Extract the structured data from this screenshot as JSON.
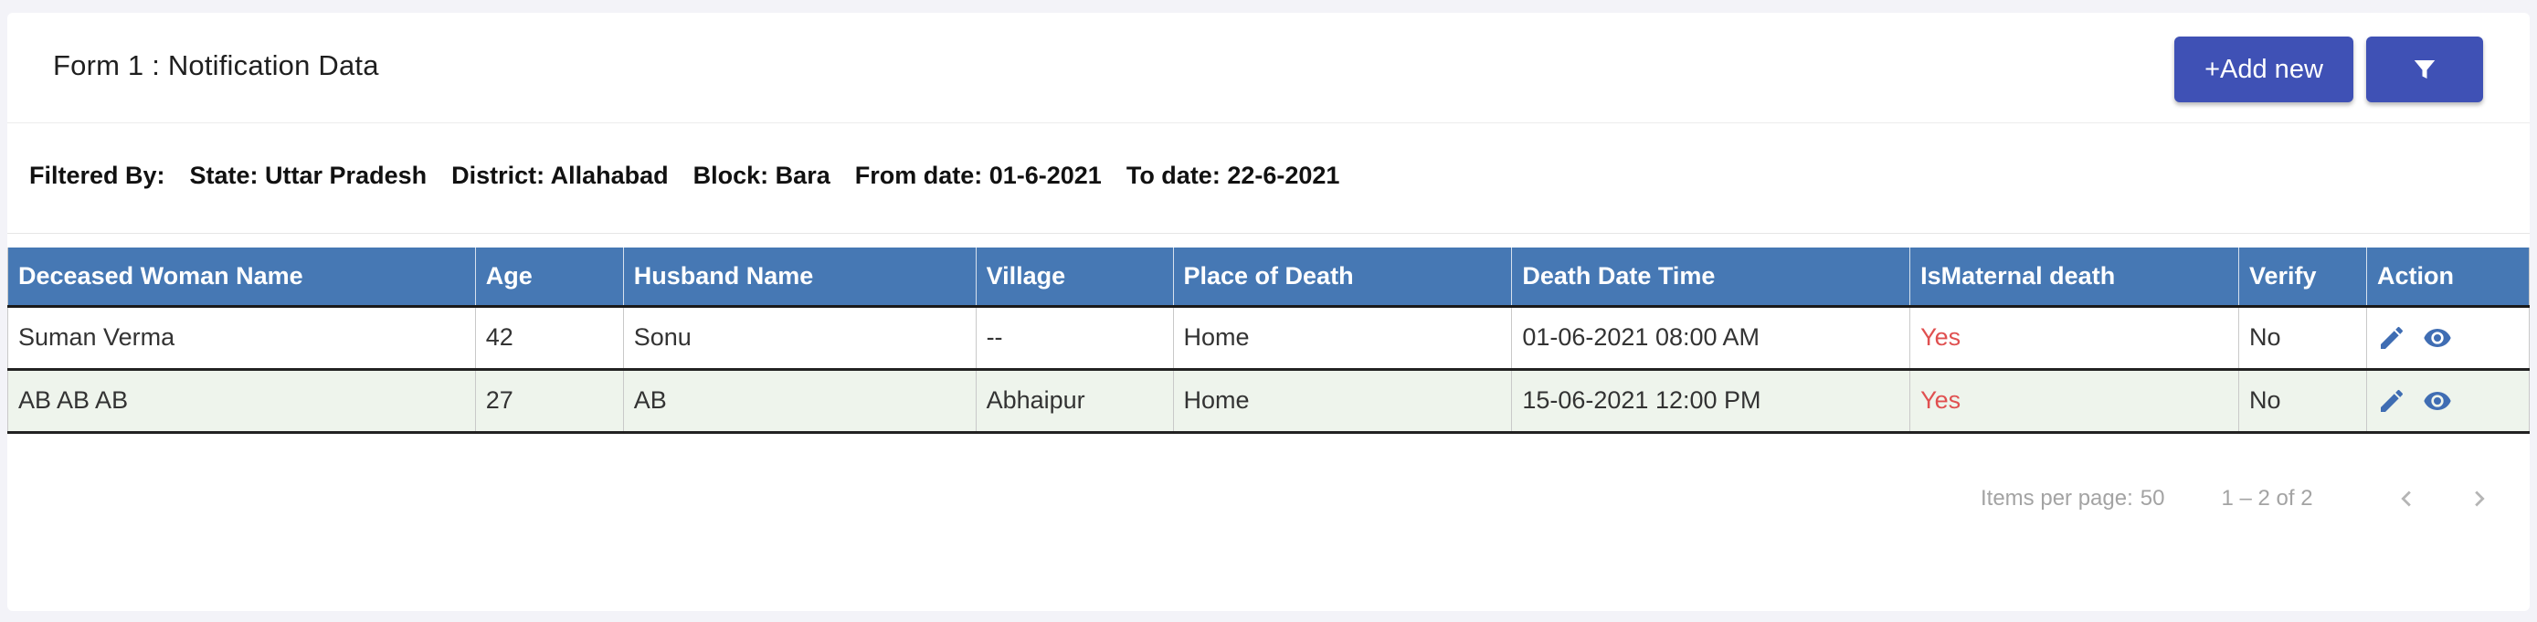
{
  "header": {
    "title": "Form 1 : Notification Data",
    "add_label": "+Add new",
    "filter_icon": "filter-icon"
  },
  "filters": {
    "label": "Filtered By:",
    "state": "State: Uttar Pradesh",
    "district": "District: Allahabad",
    "block": "Block: Bara",
    "from_date": "From date: 01-6-2021",
    "to_date": "To date: 22-6-2021"
  },
  "table": {
    "columns": [
      "Deceased Woman Name",
      "Age",
      "Husband Name",
      "Village",
      "Place of Death",
      "Death Date Time",
      "IsMaternal death",
      "Verify",
      "Action"
    ],
    "rows": [
      {
        "name": "Suman Verma",
        "age": "42",
        "husband": "Sonu",
        "village": "--",
        "place": "Home",
        "datetime": "01-06-2021 08:00 AM",
        "maternal": "Yes",
        "verify": "No"
      },
      {
        "name": "AB AB AB",
        "age": "27",
        "husband": "AB",
        "village": "Abhaipur",
        "place": "Home",
        "datetime": "15-06-2021 12:00 PM",
        "maternal": "Yes",
        "verify": "No"
      }
    ],
    "action_icons": [
      "edit-icon",
      "view-icon"
    ]
  },
  "paginator": {
    "items_per_page_label": "Items per page:",
    "items_per_page": "50",
    "range": "1 – 2 of 2"
  },
  "colors": {
    "primary": "#3f51b5",
    "table_header": "#4678b4",
    "yes": "#e05050",
    "alt_row": "#eef4ec"
  }
}
